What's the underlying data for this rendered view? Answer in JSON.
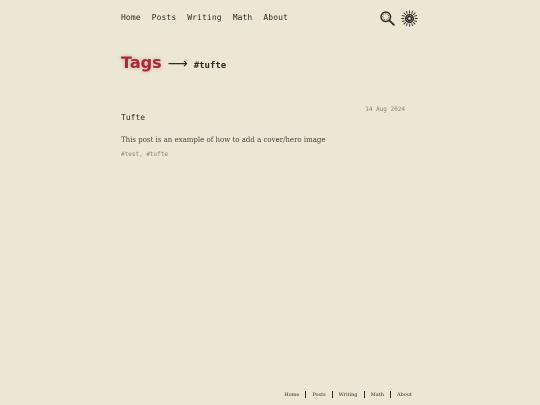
{
  "nav": {
    "items": [
      {
        "label": "Home"
      },
      {
        "label": "Posts"
      },
      {
        "label": "Writing"
      },
      {
        "label": "Math"
      },
      {
        "label": "About"
      }
    ],
    "icons": [
      "search-icon",
      "theme-toggle-icon"
    ]
  },
  "page": {
    "heading": "Tags",
    "arrow": "⟶",
    "tag": "#tufte"
  },
  "post": {
    "title": "Tufte",
    "date": "14 Aug 2024",
    "summary": "This post is an example of how to add a cover/hero image",
    "tags": [
      "#test",
      "#tufte"
    ],
    "tag_separator": ","
  },
  "footer": {
    "items": [
      {
        "label": "Home"
      },
      {
        "label": "Posts"
      },
      {
        "label": "Writing"
      },
      {
        "label": "Math"
      },
      {
        "label": "About"
      }
    ]
  },
  "colors": {
    "background": "#ece6d5",
    "accent": "#a52a36",
    "text": "#2f2a26",
    "muted": "#8a8377"
  }
}
